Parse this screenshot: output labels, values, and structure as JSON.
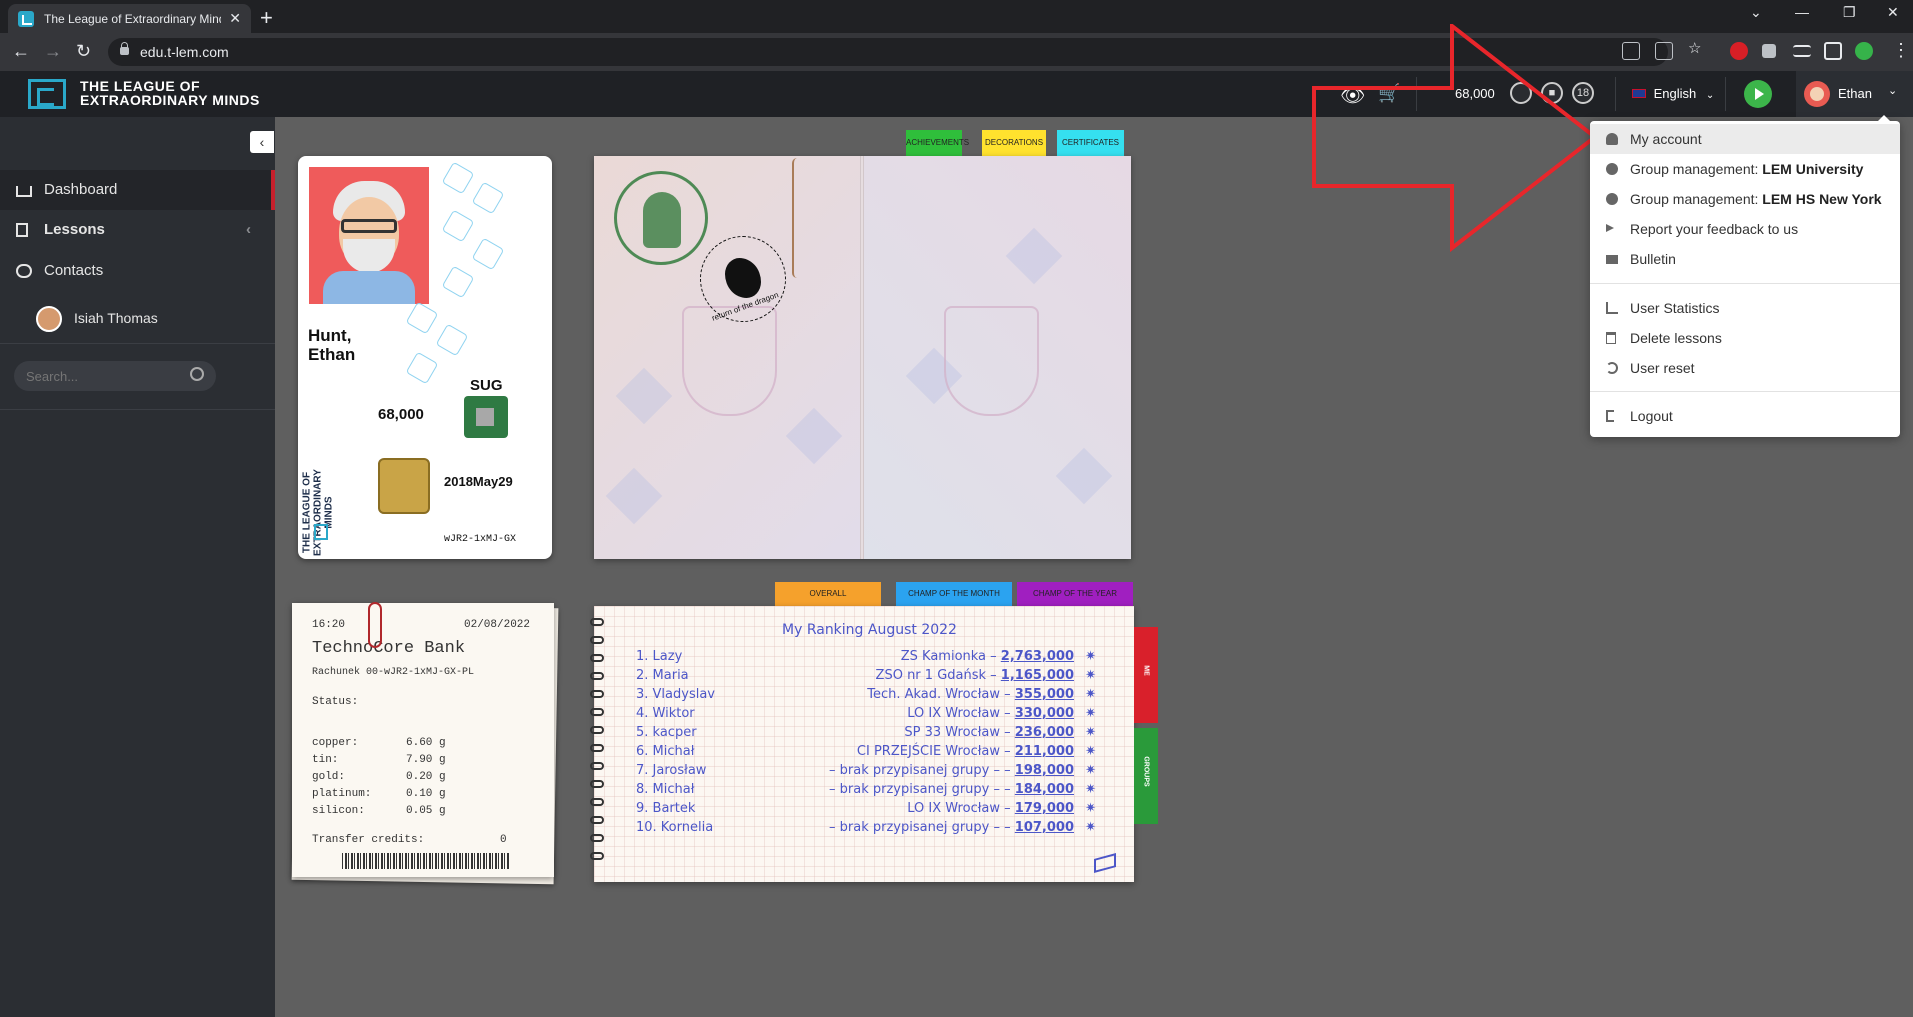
{
  "browser": {
    "tab_title": "The League of Extraordinary Minds",
    "url": "edu.t-lem.com",
    "new_tab": "+",
    "close": "✕"
  },
  "header": {
    "logo_line1": "THE LEAGUE OF",
    "logo_line2": "EXTRAORDINARY MINDS",
    "points": "68,000",
    "coin3_label": "18",
    "language": "English",
    "user_name": "Ethan"
  },
  "sidebar": {
    "items": [
      {
        "label": "Dashboard"
      },
      {
        "label": "Lessons"
      },
      {
        "label": "Contacts"
      },
      {
        "label": "Isiah Thomas"
      }
    ],
    "search_placeholder": "Search..."
  },
  "id_card": {
    "last_name": "Hunt,",
    "first_name": "Ethan",
    "vertical_line1": "THE LEAGUE OF",
    "vertical_line2": "EXTRAORDINARY MINDS",
    "badge": "SUG",
    "points": "68,000",
    "date": "2018May29",
    "code": "wJR2-1xMJ-GX"
  },
  "passport": {
    "tabs": [
      "ACHIEVEMENTS",
      "DECORATIONS",
      "CERTIFICATES"
    ],
    "tab_colors": [
      "#2fbf3b",
      "#ffe22e",
      "#35e0f0"
    ],
    "stamp_text": "return of the dragon"
  },
  "receipt": {
    "time": "16:20",
    "date": "02/08/2022",
    "bank": "TechnoCore Bank",
    "account": "Rachunek 00-wJR2-1xMJ-GX-PL",
    "status_label": "Status:",
    "metals": [
      {
        "name": "copper:",
        "value": "6.60 g"
      },
      {
        "name": "tin:",
        "value": "7.90 g"
      },
      {
        "name": "gold:",
        "value": "0.20 g"
      },
      {
        "name": "platinum:",
        "value": "0.10 g"
      },
      {
        "name": "silicon:",
        "value": "0.05 g"
      }
    ],
    "credits_label": "Transfer credits:",
    "credits_value": "0"
  },
  "ranking": {
    "tabs": [
      "OVERALL",
      "CHAMP OF THE MONTH",
      "CHAMP OF THE YEAR"
    ],
    "tab_colors": [
      "#f5a12c",
      "#2ba3f0",
      "#a01fc0"
    ],
    "side_tabs": [
      "ME",
      "GROUPS"
    ],
    "side_tab_colors": [
      "#d9202b",
      "#2a9a3a"
    ],
    "title": "My Ranking  August  2022",
    "rows": [
      {
        "name": "1. Lazy",
        "group": "ZS Kamionka –",
        "score": "2,763,000"
      },
      {
        "name": "2. Maria",
        "group": "ZSO nr 1 Gdańsk –",
        "score": "1,165,000"
      },
      {
        "name": "3. Vladyslav",
        "group": "Tech. Akad. Wrocław –",
        "score": "355,000"
      },
      {
        "name": "4. Wiktor",
        "group": "LO IX Wrocław –",
        "score": "330,000"
      },
      {
        "name": "5. kacper",
        "group": "SP 33 Wrocław –",
        "score": "236,000"
      },
      {
        "name": "6. Michał",
        "group": "CI PRZEJŚCIE Wrocław –",
        "score": "211,000"
      },
      {
        "name": "7. Jarosław",
        "group": "– brak przypisanej grupy – –",
        "score": "198,000"
      },
      {
        "name": "8. Michał",
        "group": "– brak przypisanej grupy – –",
        "score": "184,000"
      },
      {
        "name": "9. Bartek",
        "group": "LO IX Wrocław –",
        "score": "179,000"
      },
      {
        "name": "10. Kornelia",
        "group": "– brak przypisanej grupy – –",
        "score": "107,000"
      }
    ],
    "star": "✷"
  },
  "user_menu": {
    "items": [
      {
        "label": "My account",
        "bold": ""
      },
      {
        "label": "Group management: ",
        "bold": "LEM University"
      },
      {
        "label": "Group management: ",
        "bold": "LEM HS New York"
      },
      {
        "label": "Report your feedback to us",
        "bold": ""
      },
      {
        "label": "Bulletin",
        "bold": ""
      },
      {
        "label": "User Statistics",
        "bold": ""
      },
      {
        "label": "Delete lessons",
        "bold": ""
      },
      {
        "label": "User reset",
        "bold": ""
      },
      {
        "label": "Logout",
        "bold": ""
      }
    ]
  },
  "colors": {
    "accent": "#2aa8c9",
    "annotation_arrow": "#e8262b"
  }
}
